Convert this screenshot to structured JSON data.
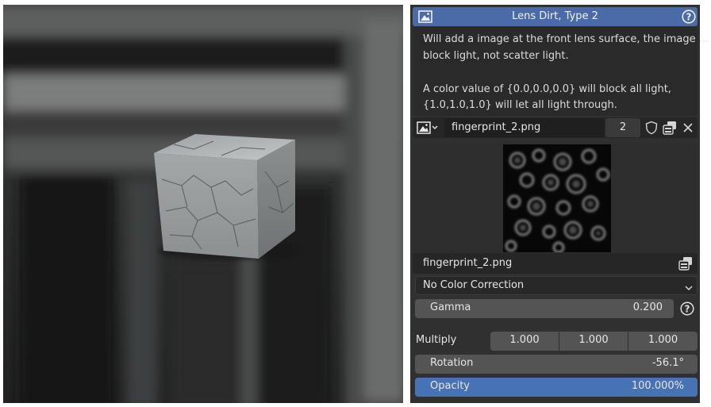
{
  "header": {
    "title": "Lens Dirt, Type 2",
    "help_icon": "question-icon"
  },
  "description": {
    "line1": "Will add a image at the front lens surface, the image ...",
    "line2": "block light, not scatter light.",
    "line3": "A color value of {0.0,0.0,0.0} will block all light,",
    "line4": "{1.0,1.0,1.0} will let all light through."
  },
  "image_selector": {
    "filename": "fingerprint_2.png",
    "users": "2"
  },
  "image_file": {
    "path": "fingerprint_2.png"
  },
  "color_correction": {
    "value": "No Color Correction"
  },
  "gamma": {
    "label": "Gamma",
    "value": "0.200"
  },
  "multiply": {
    "label": "Multiply",
    "values": [
      "1.000",
      "1.000",
      "1.000"
    ]
  },
  "rotation": {
    "label": "Rotation",
    "value": "-56.1°"
  },
  "opacity": {
    "label": "Opacity",
    "value": "100.000%",
    "fraction": 1.0
  },
  "colors": {
    "accent": "#4772b3",
    "header": "#4a6aa8",
    "panel": "#303030",
    "field": "#545454"
  }
}
